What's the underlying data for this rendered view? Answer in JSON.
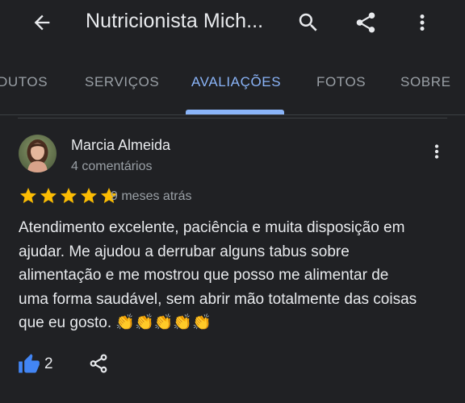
{
  "appbar": {
    "title": "Nutricionista Mich...",
    "icons": {
      "back": "arrow-back-icon",
      "search": "search-icon",
      "share": "share-icon",
      "more": "more-vert-icon"
    }
  },
  "tabs": [
    {
      "label": "DUTOS",
      "active": false
    },
    {
      "label": "SERVIÇOS",
      "active": false
    },
    {
      "label": "AVALIAÇÕES",
      "active": true
    },
    {
      "label": "FOTOS",
      "active": false
    },
    {
      "label": "SOBRE",
      "active": false
    }
  ],
  "review": {
    "author": "Marcia Almeida",
    "author_meta": "4 comentários",
    "rating": 5,
    "rating_max": 5,
    "time": "9 meses atrás",
    "text": "Atendimento excelente, paciência e muita disposição em ajudar. Me ajudou a derrubar alguns tabus sobre alimentação e me mostrou que posso me alimentar de uma forma saudável, sem abrir mão totalmente das coisas que eu gosto. 👏👏👏👏👏",
    "likes": "2"
  },
  "colors": {
    "background": "#202124",
    "text_primary": "#e8eaed",
    "text_secondary": "#9aa0a6",
    "accent": "#8ab4f8",
    "star": "#fbbc04",
    "like": "#4285f4",
    "divider": "#3c4043"
  }
}
